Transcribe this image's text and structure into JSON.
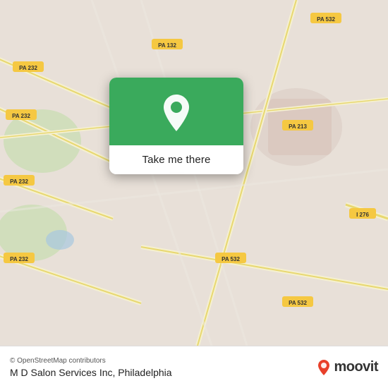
{
  "map": {
    "background_color": "#e8e0d8",
    "roads": [
      {
        "label": "PA 232",
        "positions": [
          "left-upper",
          "left-mid",
          "left-lower"
        ]
      },
      {
        "label": "PA 532",
        "positions": [
          "right-upper",
          "center-lower"
        ]
      },
      {
        "label": "PA 213",
        "positions": [
          "right-mid"
        ]
      },
      {
        "label": "I 276",
        "positions": [
          "right-lower"
        ]
      },
      {
        "label": "PA 132",
        "positions": [
          "center-upper"
        ]
      }
    ]
  },
  "popup": {
    "button_label": "Take me there",
    "pin_color": "#ffffff",
    "background_color": "#3aaa5c"
  },
  "bottom_bar": {
    "attribution": "© OpenStreetMap contributors",
    "business_name": "M D Salon Services Inc, Philadelphia",
    "logo_text": "moovit"
  }
}
